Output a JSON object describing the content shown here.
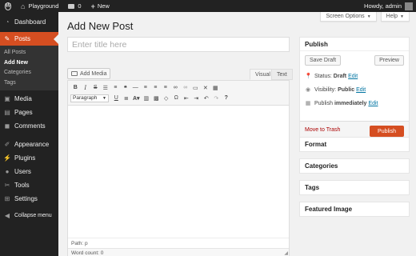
{
  "adminbar": {
    "site_name": "Playground",
    "comments_count": "0",
    "new_label": "New",
    "howdy": "Howdy, admin"
  },
  "sidebar": {
    "items": [
      {
        "label": "Dashboard",
        "icon": "dashboard-icon"
      },
      {
        "label": "Posts",
        "icon": "pin-icon",
        "active": true
      },
      {
        "label": "Media",
        "icon": "media-icon"
      },
      {
        "label": "Pages",
        "icon": "pages-icon"
      },
      {
        "label": "Comments",
        "icon": "comments-icon"
      },
      {
        "label": "Appearance",
        "icon": "appearance-icon"
      },
      {
        "label": "Plugins",
        "icon": "plugins-icon"
      },
      {
        "label": "Users",
        "icon": "users-icon"
      },
      {
        "label": "Tools",
        "icon": "tools-icon"
      },
      {
        "label": "Settings",
        "icon": "settings-icon"
      },
      {
        "label": "Collapse menu",
        "icon": "collapse-icon"
      }
    ],
    "posts_submenu": [
      "All Posts",
      "Add New",
      "Categories",
      "Tags"
    ],
    "active_color": "#d54e21"
  },
  "header": {
    "screen_options": "Screen Options",
    "help": "Help",
    "page_title": "Add New Post"
  },
  "editor": {
    "title_placeholder": "Enter title here",
    "add_media": "Add Media",
    "tab_visual": "Visual",
    "tab_text": "Text",
    "format_select": "Paragraph",
    "path": "Path: p",
    "word_count": "Word count: 0"
  },
  "publish": {
    "title": "Publish",
    "save_draft": "Save Draft",
    "preview": "Preview",
    "status_label": "Status:",
    "status_value": "Draft",
    "visibility_label": "Visibility:",
    "visibility_value": "Public",
    "publish_label": "Publish",
    "publish_value": "immediately",
    "edit": "Edit",
    "move_to_trash": "Move to Trash",
    "publish_button": "Publish"
  },
  "boxes": {
    "format": "Format",
    "categories": "Categories",
    "tags": "Tags",
    "featured_image": "Featured Image"
  }
}
